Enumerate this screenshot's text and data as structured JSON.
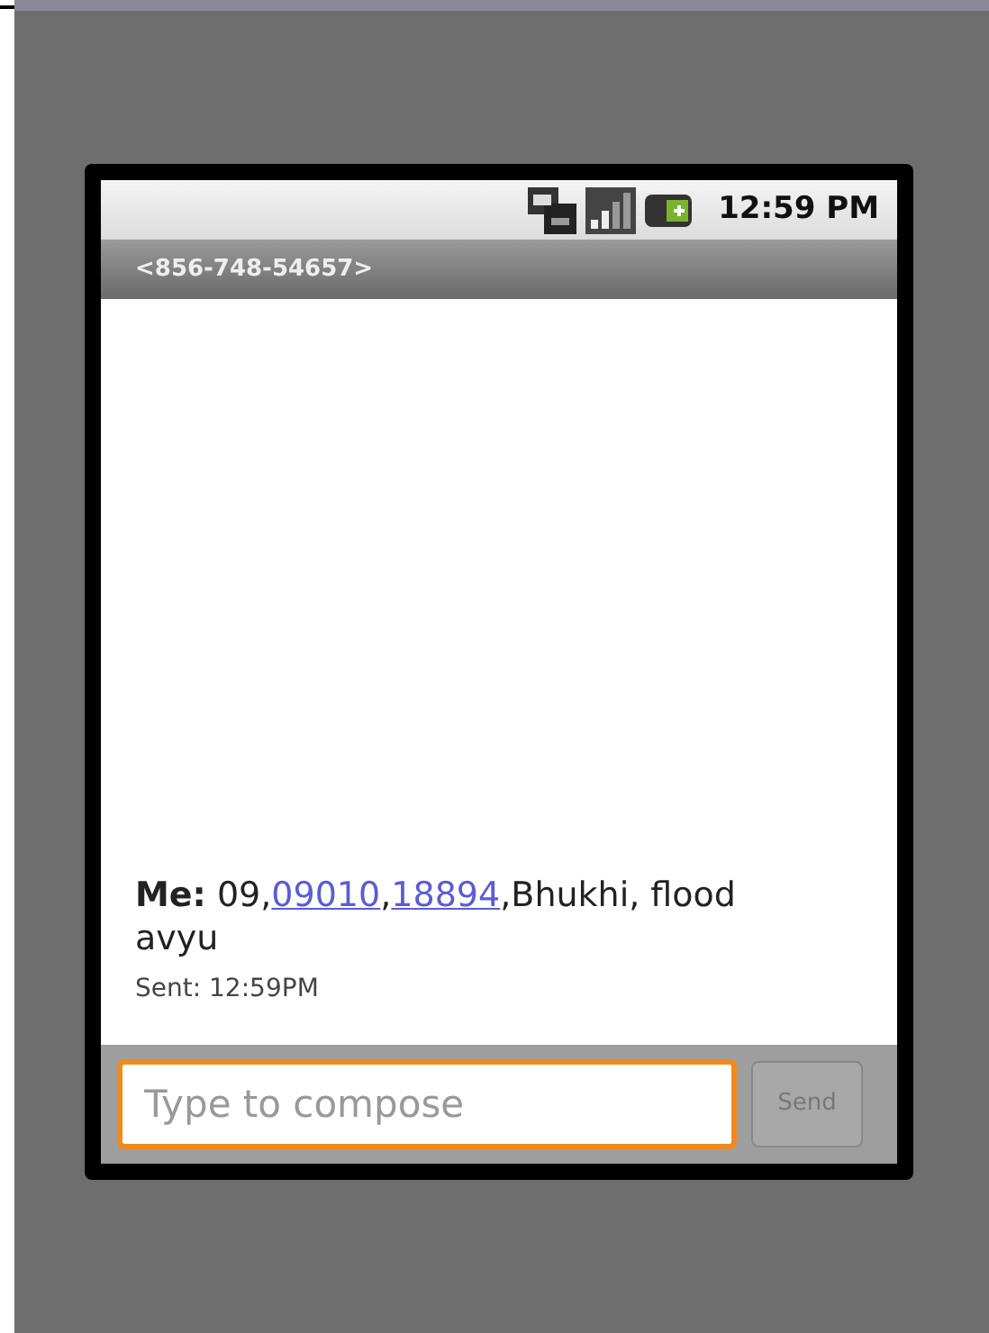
{
  "status_bar": {
    "time": "12:59 PM"
  },
  "title_bar": {
    "title": "<856-748-54657>"
  },
  "messages": [
    {
      "sender": "Me:",
      "parts": [
        {
          "kind": "text",
          "text": " 09,"
        },
        {
          "kind": "link",
          "text": "09010"
        },
        {
          "kind": "text",
          "text": ","
        },
        {
          "kind": "link",
          "text": "18894"
        },
        {
          "kind": "text",
          "text": ",Bhukhi, flood avyu"
        }
      ],
      "status": "Sent: 12:59PM"
    }
  ],
  "compose": {
    "placeholder": "Type to compose",
    "focused": true,
    "send_label": "Send",
    "send_disabled": true
  }
}
